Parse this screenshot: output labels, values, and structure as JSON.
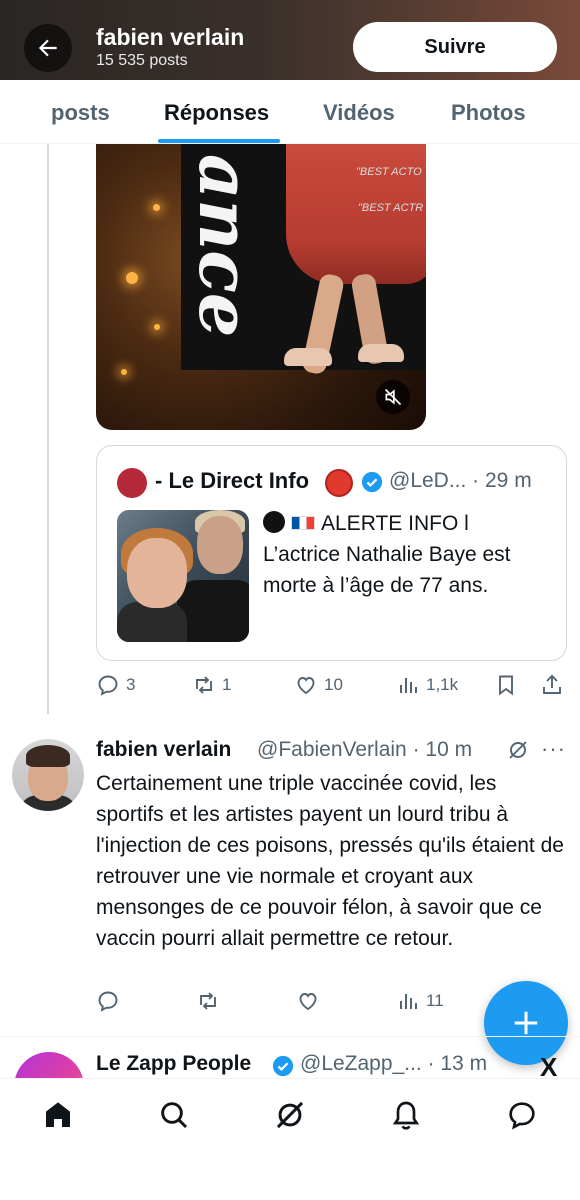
{
  "header": {
    "name": "fabien verlain",
    "post_count": "15 535 posts",
    "follow_label": "Suivre"
  },
  "tabs": [
    {
      "label": "posts",
      "active": false
    },
    {
      "label": "Réponses",
      "active": true
    },
    {
      "label": "Vidéos",
      "active": false
    },
    {
      "label": "Photos",
      "active": false
    }
  ],
  "media": {
    "lines": [
      "\"BEST ACTO",
      "\"BEST ACTR"
    ],
    "script_text": "ance"
  },
  "quote": {
    "name": "- Le Direct Info",
    "handle": "@LeD... · 29 m",
    "text_lines": [
      "ALERTE INFO l",
      "L’actrice Nathalie Baye est",
      "morte à l’âge de 77 ans."
    ]
  },
  "tweet1_actions": {
    "replies": "3",
    "reposts": "1",
    "likes": "10",
    "views": "1,1k"
  },
  "tweet2": {
    "name": "fabien verlain",
    "handle": "@FabienVerlain · 10 m",
    "more": "···",
    "text": "Certainement une triple vaccinée covid, les sportifs et les artistes payent un lourd tribu à l'injection de ces poisons, pressés qu'ils étaient de retrouver une vie normale et croyant aux mensonges de ce pouvoir félon, à savoir que ce vaccin pourri allait permettre ce retour.",
    "views": "11"
  },
  "tweet3": {
    "name": "Le Zapp People",
    "handle": "@LeZapp_... · 13 m",
    "source_icon": "X"
  },
  "nav": [
    "home-icon",
    "search-icon",
    "grok-icon",
    "notifications-icon",
    "messages-icon"
  ],
  "colors": {
    "accent": "#1d9bf0",
    "text": "#0f1419",
    "muted": "#536471"
  }
}
